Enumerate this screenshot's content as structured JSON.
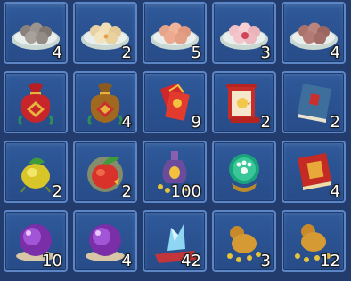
{
  "slots": [
    {
      "item": "plate-dumplings-grey",
      "icon": "dumpling-plate-icon",
      "count": "4"
    },
    {
      "item": "plate-dumplings-cream",
      "icon": "dumpling-plate-icon",
      "count": "2"
    },
    {
      "item": "plate-dumplings-pink",
      "icon": "dumpling-plate-icon",
      "count": "5"
    },
    {
      "item": "plate-dumplings-rose",
      "icon": "dumpling-plate-icon",
      "count": "3"
    },
    {
      "item": "plate-dumplings-brown",
      "icon": "dumpling-plate-icon",
      "count": "4"
    },
    {
      "item": "red-lucky-bag",
      "icon": "lucky-bag-icon",
      "count": ""
    },
    {
      "item": "gold-lucky-bag",
      "icon": "lucky-bag-icon",
      "count": "4"
    },
    {
      "item": "red-envelopes",
      "icon": "red-envelope-icon",
      "count": "9"
    },
    {
      "item": "chick-scroll",
      "icon": "scroll-icon",
      "count": "2"
    },
    {
      "item": "blue-book",
      "icon": "book-icon",
      "count": "2"
    },
    {
      "item": "golden-fruit",
      "icon": "fruit-icon",
      "count": "2"
    },
    {
      "item": "glowing-peach",
      "icon": "peach-icon",
      "count": "2"
    },
    {
      "item": "potion-vase",
      "icon": "vase-icon",
      "count": "100"
    },
    {
      "item": "paw-crystal-orb",
      "icon": "crystal-orb-icon",
      "count": ""
    },
    {
      "item": "red-tome",
      "icon": "tome-icon",
      "count": "4"
    },
    {
      "item": "purple-orb",
      "icon": "purple-orb-icon",
      "count": "10"
    },
    {
      "item": "purple-orb-2",
      "icon": "purple-orb-icon",
      "count": "4"
    },
    {
      "item": "ice-crystal-carpet",
      "icon": "crystal-icon",
      "count": "42"
    },
    {
      "item": "gourd-coins",
      "icon": "gourd-icon",
      "count": "3"
    },
    {
      "item": "gourd-coins-2",
      "icon": "gourd-icon",
      "count": "12"
    }
  ]
}
